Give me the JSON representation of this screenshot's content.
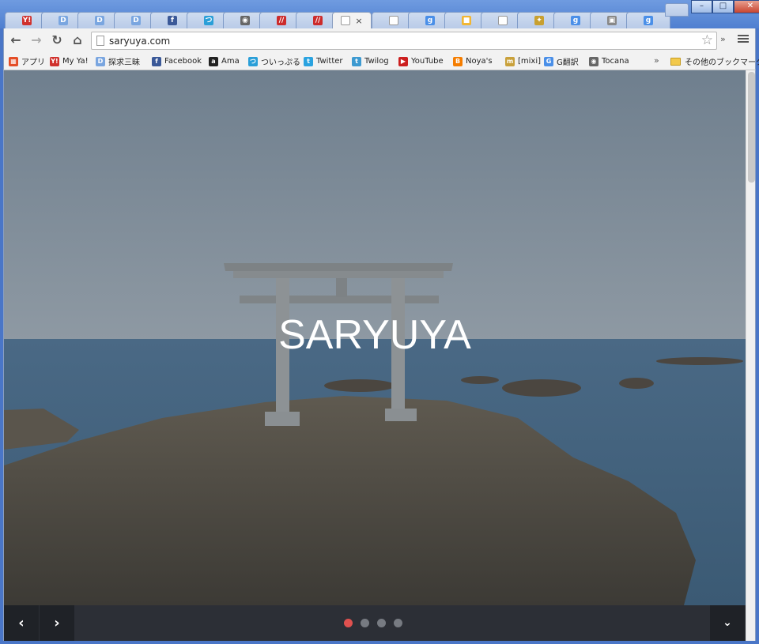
{
  "window": {
    "minimize": "–",
    "maximize": "□",
    "close": "✕"
  },
  "tabs": [
    {
      "icon": "Y!",
      "color": "#d0312d",
      "active": false
    },
    {
      "icon": "D",
      "color": "#7aa6e0",
      "active": false
    },
    {
      "icon": "D",
      "color": "#7aa6e0",
      "active": false
    },
    {
      "icon": "D",
      "color": "#7aa6e0",
      "active": false
    },
    {
      "icon": "f",
      "color": "#3b5998",
      "active": false
    },
    {
      "icon": "つ",
      "color": "#2a9fd8",
      "active": false
    },
    {
      "icon": "◉",
      "color": "#666666",
      "active": false
    },
    {
      "icon": "//",
      "color": "#cc2b2b",
      "active": false
    },
    {
      "icon": "//",
      "color": "#cc2b2b",
      "active": false
    },
    {
      "icon": "",
      "color": "#ffffff",
      "active": true,
      "close": "×"
    },
    {
      "icon": "",
      "color": "#ffffff",
      "active": false
    },
    {
      "icon": "g",
      "color": "#4a8fe8",
      "active": false
    },
    {
      "icon": "■",
      "color": "#f2b632",
      "active": false
    },
    {
      "icon": "",
      "color": "#ffffff",
      "active": false
    },
    {
      "icon": "✦",
      "color": "#c8a030",
      "active": false
    },
    {
      "icon": "g",
      "color": "#4a8fe8",
      "active": false
    },
    {
      "icon": "▣",
      "color": "#888888",
      "active": false
    },
    {
      "icon": "g",
      "color": "#4a8fe8",
      "active": false
    }
  ],
  "toolbar": {
    "back": "←",
    "forward": "→",
    "reload": "↻",
    "home": "⌂",
    "url": "saryuya.com",
    "more": "»"
  },
  "bookmarks": [
    {
      "label": "アプリ",
      "icon": "▦",
      "color": "#e44d26"
    },
    {
      "label": "My Ya!",
      "icon": "Y!",
      "color": "#d0312d"
    },
    {
      "label": "探求三昧",
      "icon": "D",
      "color": "#7aa6e0"
    },
    {
      "label": "Facebook",
      "icon": "f",
      "color": "#3b5998"
    },
    {
      "label": "Ama",
      "icon": "a",
      "color": "#222222"
    },
    {
      "label": "ついっぷる",
      "icon": "つ",
      "color": "#2a9fd8"
    },
    {
      "label": "Twitter",
      "icon": "t",
      "color": "#2aa3e0"
    },
    {
      "label": "Twilog",
      "icon": "t",
      "color": "#3d9ad1"
    },
    {
      "label": "YouTube",
      "icon": "▶",
      "color": "#cc1f1f"
    },
    {
      "label": "Noya's",
      "icon": "B",
      "color": "#f57d00"
    },
    {
      "label": "[mixi]",
      "icon": "m",
      "color": "#c9a13b"
    },
    {
      "label": "G翻訳",
      "icon": "G",
      "color": "#4a8fe8"
    },
    {
      "label": "Tocana",
      "icon": "◉",
      "color": "#666666"
    }
  ],
  "bookmarks_overflow": "»",
  "other_bookmarks": "その他のブックマーク",
  "hero": {
    "title": "SARYUYA"
  },
  "slider": {
    "prev": "‹",
    "next": "›",
    "down": "⌄",
    "slide_count": 4,
    "active_slide": 1
  },
  "colors": {
    "sky": "#7a8a99",
    "sea": "#3f607e",
    "rock": "#504c45",
    "dot_active": "#e0514f",
    "dot_inactive": "#777b82",
    "control_bar": "#2c2f36"
  }
}
